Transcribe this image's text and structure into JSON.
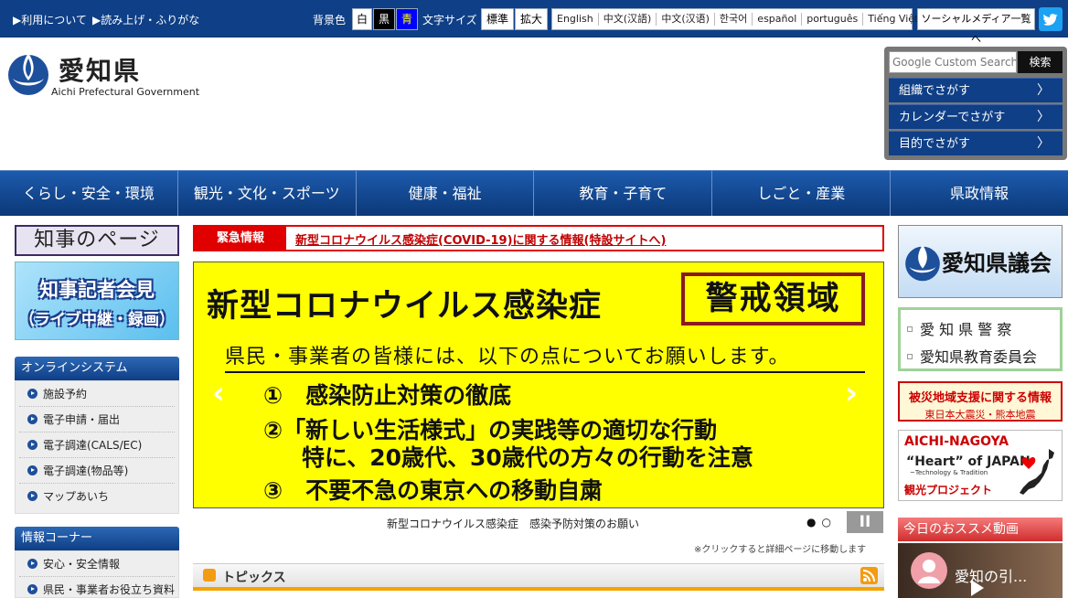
{
  "topbar": {
    "about": "▶利用について",
    "readaloud": "▶読み上げ・ふりがな",
    "bgcolor_label": "背景色",
    "bg_white": "白",
    "bg_black": "黒",
    "bg_blue": "青",
    "fontsize_label": "文字サイズ",
    "font_standard": "標準",
    "font_large": "拡大",
    "languages": [
      "English",
      "中文(汉語)",
      "中文(汉语)",
      "한국어",
      "español",
      "português",
      "Tiếng Việt"
    ],
    "social_list": "ソーシャルメディア一覧へ",
    "twitter_icon": "twitter-icon"
  },
  "header": {
    "title": "愛知県",
    "subtitle": "Aichi Prefectural Government"
  },
  "search": {
    "placeholder": "Google Custom Search",
    "button": "検索",
    "links": [
      "組織でさがす",
      "カレンダーでさがす",
      "目的でさがす"
    ]
  },
  "nav": [
    "くらし・安全・環境",
    "観光・文化・スポーツ",
    "健康・福祉",
    "教育・子育て",
    "しごと・産業",
    "県政情報"
  ],
  "left": {
    "governor_page": "知事のページ",
    "press_line1": "知事記者会見",
    "press_line2": "（ライブ中継・録画）",
    "online_head": "オンラインシステム",
    "online_items": [
      "施設予約",
      "電子申請・届出",
      "電子調達(CALS/EC)",
      "電子調達(物品等)",
      "マップあいち"
    ],
    "info_head": "情報コーナー",
    "info_items": [
      "安心・安全情報",
      "県民・事業者お役立ち資料"
    ]
  },
  "emergency": {
    "label": "緊急情報",
    "link": "新型コロナウイルス感染症(COVID-19)に関する情報(特設サイトへ)"
  },
  "banner": {
    "title": "新型コロナウイルス感染症",
    "alert": "警戒領域",
    "subtitle": "県民・事業者の皆様には、以下の点についてお願いします。",
    "line1": "①　感染防止対策の徹底",
    "line2": "②「新しい生活様式」の実践等の適切な行動",
    "line3": "特に、20歳代、30歳代の方々の行動を注意",
    "line4": "③　不要不急の東京への移動自粛",
    "caption": "新型コロナウイルス感染症　感染予防対策のお願い",
    "dots": "●○",
    "pause": "II",
    "click_note": "※クリックすると詳細ページに移動します",
    "prev_arrow": "‹",
    "next_arrow": "›"
  },
  "topics": {
    "label": "トピックス"
  },
  "right": {
    "gikai": "愛知県議会",
    "police": "愛 知 県 警 察",
    "education": "愛知県教育委員会",
    "disaster_a": "被災地域支援に関する情報",
    "disaster_b": "東日本大震災・熊本地震",
    "aichi_a": "AICHI-NAGOYA",
    "aichi_b": "“Heart” of JAPAN",
    "aichi_c": "~Technology & Tradition",
    "aichi_d": "観光プロジェクト",
    "video_head": "今日のおススメ動画",
    "video_title": "愛知の引..."
  }
}
